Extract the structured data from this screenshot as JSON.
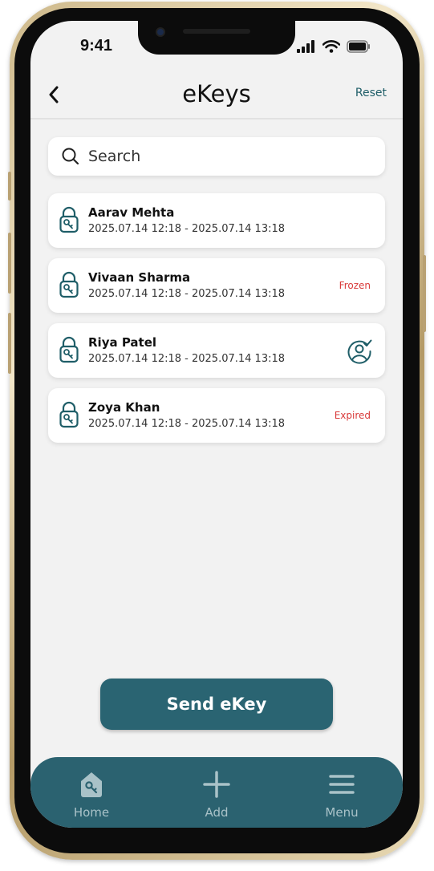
{
  "status_bar": {
    "time": "9:41"
  },
  "header": {
    "title": "eKeys",
    "reset_label": "Reset"
  },
  "search": {
    "placeholder": "Search"
  },
  "ekeys": [
    {
      "name": "Aarav Mehta",
      "range": "2025.07.14 12:18 - 2025.07.14 13:18",
      "status": ""
    },
    {
      "name": "Vivaan Sharma",
      "range": "2025.07.14 12:18 - 2025.07.14 13:18",
      "status": "Frozen"
    },
    {
      "name": "Riya Patel",
      "range": "2025.07.14 12:18 - 2025.07.14 13:18",
      "status": "user-check-icon"
    },
    {
      "name": "Zoya Khan",
      "range": "2025.07.14 12:18 - 2025.07.14 13:18",
      "status": "Expired"
    }
  ],
  "actions": {
    "send_label": "Send eKey"
  },
  "bottom_nav": [
    {
      "label": "Home",
      "icon": "home-key-icon"
    },
    {
      "label": "Add",
      "icon": "plus-icon"
    },
    {
      "label": "Menu",
      "icon": "menu-icon"
    }
  ],
  "colors": {
    "accent": "#2b6270",
    "status_red": "#d93a3a",
    "nav_label": "#a9c2c8"
  }
}
